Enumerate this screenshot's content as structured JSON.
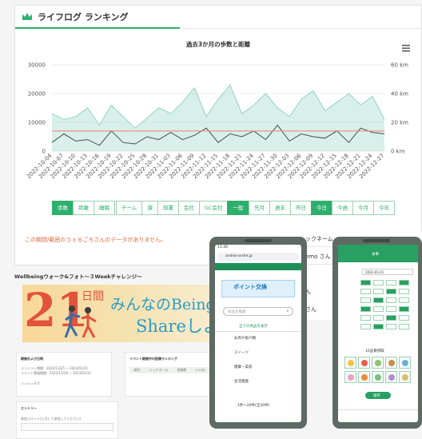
{
  "card": {
    "title": "ライフログ ランキング",
    "icon": "crown-icon"
  },
  "chart_data": {
    "type": "line",
    "title": "過去3か月の歩数と距離",
    "y_left": {
      "ticks": [
        0,
        10000,
        20000,
        30000
      ],
      "range": [
        0,
        30000
      ]
    },
    "y_right": {
      "ticks": [
        "0 km",
        "20 km",
        "40 km",
        "60 km"
      ],
      "range": [
        0,
        60
      ]
    },
    "x": [
      "2022-10-04",
      "2022-10-07",
      "2022-10-10",
      "2022-10-13",
      "2022-10-16",
      "2022-10-19",
      "2022-10-22",
      "2022-10-25",
      "2022-10-28",
      "2022-10-31",
      "2022-11-03",
      "2022-11-06",
      "2022-11-09",
      "2022-11-12",
      "2022-11-15",
      "2022-11-18",
      "2022-11-21",
      "2022-11-24",
      "2022-11-27",
      "2022-11-30",
      "2022-12-03",
      "2022-12-06",
      "2022-12-09",
      "2022-12-12",
      "2022-12-15",
      "2022-12-18",
      "2022-12-21",
      "2022-12-24",
      "2022-12-27"
    ],
    "series": [
      {
        "values": [
          13000,
          11000,
          12000,
          15000,
          9000,
          16000,
          12000,
          8000,
          11500,
          15000,
          13000,
          17000,
          22000,
          12000,
          18000,
          23000,
          13000,
          16000,
          20000,
          15000,
          12000,
          18000,
          21000,
          14000,
          17000,
          20000,
          16000,
          19000,
          11000
        ],
        "color": "#8fd3c1"
      },
      {
        "values": [
          3000,
          6000,
          3500,
          4000,
          2000,
          7000,
          3000,
          2500,
          5000,
          4000,
          6500,
          4000,
          5500,
          8000,
          3000,
          6000,
          5000,
          7000,
          4000,
          9000,
          3500,
          6000,
          5000,
          4500,
          7000,
          3000,
          8000,
          6500,
          6000
        ],
        "color": "#4a4a4a"
      },
      {
        "values": [
          7000,
          7000,
          7000,
          7000,
          7000,
          7000,
          7000,
          7000,
          7000,
          7000,
          7000,
          7000,
          7000,
          7000,
          7000,
          7000,
          7000,
          7000,
          7000,
          7000,
          7000,
          7000,
          7000,
          7000,
          7000,
          7000,
          7000,
          7000,
          7000
        ],
        "color": "#f08a7a"
      }
    ],
    "grid": true
  },
  "buttons": {
    "metric": [
      "歩数",
      "距離",
      "睡眠"
    ],
    "scope": [
      "チーム",
      "課",
      "部署",
      "会社",
      "GC会社",
      "一般"
    ],
    "period": [
      "先月",
      "週末",
      "昨日",
      "今日",
      "今週",
      "今月",
      "今年"
    ]
  },
  "no_data": "この期間/範囲のうぇるごろさんのデータがありません。",
  "wellbeing": {
    "title": "Wellbeingウォーク&フォト～３Weekチャレンジ～",
    "banner_num": "21",
    "banner_days": "日間",
    "banner_line1": "みんなのBeing",
    "banner_line2": "Shareしよう"
  },
  "lower_panels": {
    "period_title": "期間および日時",
    "period_line1": "エントリー期間：2022/12/25 ~ 2023/01/31",
    "period_line2": "イベント実施期間：2022/12/26 ~ 2023/01/31",
    "hashtag": "ハッシュタグ",
    "ranking_title": "イベント期間中の投稿ランキング",
    "ranking_cols": [
      "順位",
      "ニックネーム",
      "投稿数",
      "いいね"
    ],
    "entry_title": "エントリー",
    "entry_hint": "参加コメント(入力して送信してください)"
  },
  "phone1": {
    "status": "11:46",
    "url": "andise-ordre.jp",
    "points_label": "ポイント交換",
    "search_placeholder": "商品を検索",
    "all_items": "全ての商品を表示",
    "menu": [
      "お肉や魚介類",
      "スイーツ",
      "健康・美容",
      "生活雑貨"
    ],
    "pager": "1件～20件(全20件)"
  },
  "phone2": {
    "header": "食事",
    "date": "2022-01-01",
    "button": "保存",
    "section": "10品目摂取"
  },
  "side_names": [
    "ックネーム",
    "emo さん",
    "ん",
    "さん"
  ]
}
